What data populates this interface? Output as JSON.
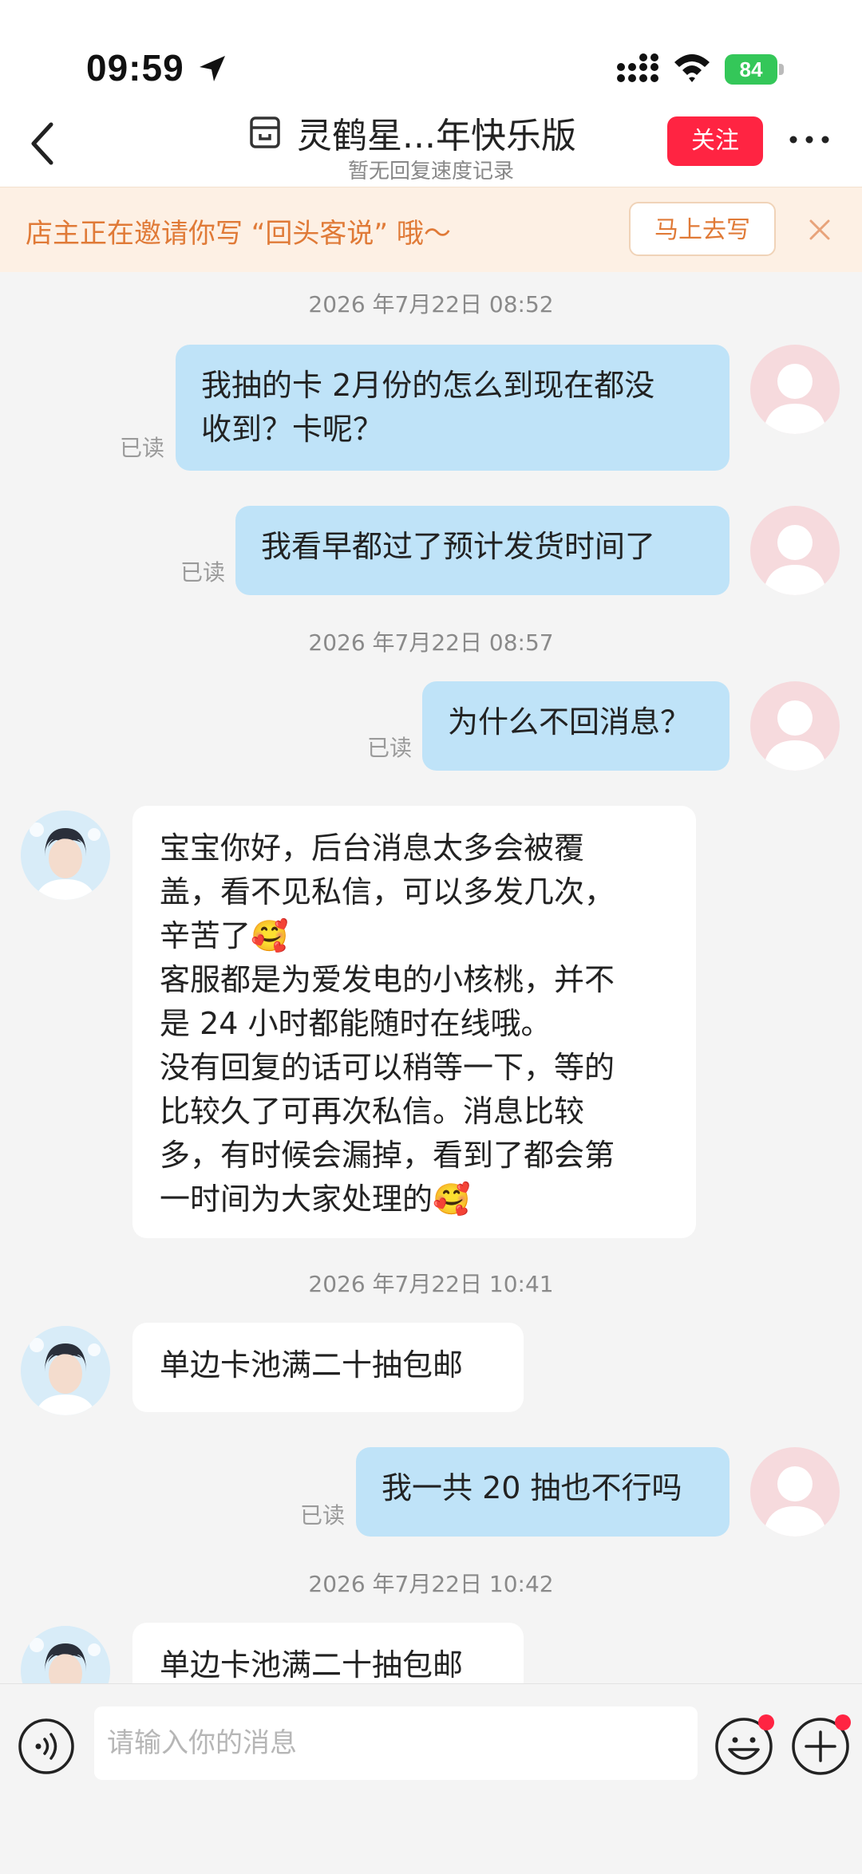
{
  "status_bar": {
    "time": "09:59",
    "battery": "84"
  },
  "nav": {
    "title": "灵鹤星...年快乐版",
    "subtitle": "暂无回复速度记录",
    "follow_label": "关注"
  },
  "banner": {
    "text": "店主正在邀请你写 “回头客说” 哦～",
    "button_label": "马上去写"
  },
  "chat": {
    "read_label": "已读",
    "timestamps": [
      "2026 年7月22日 08:52",
      "2026 年7月22日 08:57",
      "2026 年7月22日 10:41",
      "2026 年7月22日 10:42"
    ],
    "messages": [
      {
        "side": "out",
        "lines": [
          "我抽的卡 2月份的怎么到现在都没",
          "收到？卡呢？"
        ]
      },
      {
        "side": "out",
        "lines": [
          "我看早都过了预计发货时间了"
        ]
      },
      {
        "side": "out",
        "lines": [
          "为什么不回消息？"
        ]
      },
      {
        "side": "in",
        "lines": [
          "宝宝你好，后台消息太多会被覆",
          "盖，看不见私信，可以多发几次，",
          "辛苦了🥰",
          "客服都是为爱发电的小核桃，并不",
          "是 24 小时都能随时在线哦。",
          "没有回复的话可以稍等一下，等的",
          "比较久了可再次私信。消息比较",
          "多，有时候会漏掉，看到了都会第",
          "一时间为大家处理的🥰"
        ]
      },
      {
        "side": "in",
        "lines": [
          "单边卡池满二十抽包邮"
        ]
      },
      {
        "side": "out",
        "lines": [
          "我一共 20 抽也不行吗"
        ]
      },
      {
        "side": "in",
        "lines": [
          "单边卡池满二十抽包邮"
        ]
      }
    ]
  },
  "input_bar": {
    "placeholder": "请输入你的消息"
  },
  "colors": {
    "accent": "#ff2442",
    "out_bubble": "#bfe3f8",
    "banner_bg": "#fdf0e4",
    "banner_text": "#e07a37"
  }
}
